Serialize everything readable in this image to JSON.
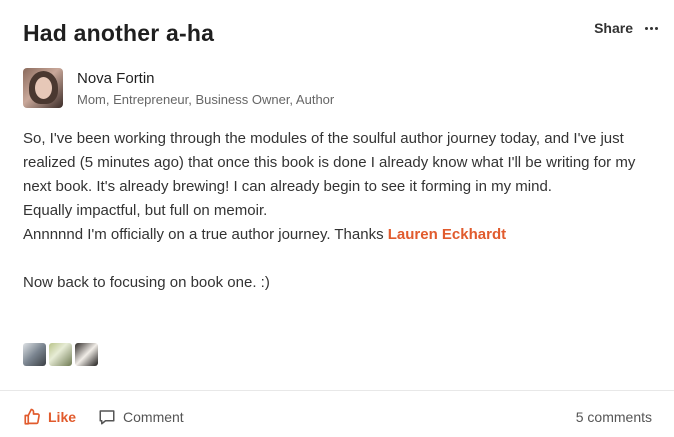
{
  "post": {
    "title": "Had another a-ha",
    "share_label": "Share",
    "author": {
      "name": "Nova Fortin",
      "role": "Mom, Entrepreneur, Business Owner, Author"
    },
    "body": {
      "line1": "So, I've been working through the modules of the soulful author journey today, and I've just realized (5 minutes ago) that once this book is done I already know what I'll be writing for my next book. It's already brewing! I can already begin to see it forming in my mind.",
      "line2": "Equally impactful, but full on memoir.",
      "line3": "Annnnnd I'm officially on a true author journey. Thanks ",
      "mention": "Lauren Eckhardt",
      "line4": "Now back to focusing on book one. :)"
    }
  },
  "actions": {
    "like_label": "Like",
    "comment_label": "Comment",
    "comments_count": "5 comments"
  },
  "colors": {
    "accent": "#e15b2d",
    "text": "#333333",
    "muted": "#666666"
  },
  "icons": [
    "more-icon",
    "thumbs-up-icon",
    "comment-icon"
  ]
}
